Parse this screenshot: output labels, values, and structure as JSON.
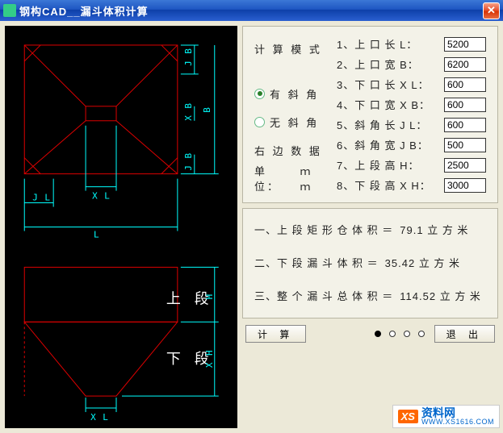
{
  "title": "钢构CAD__漏斗体积计算",
  "cad": {
    "labels": {
      "L": "L",
      "JL": "J L",
      "XL": "X L",
      "B": "B",
      "JB": "J B",
      "XB": "X B",
      "upper": "上 段",
      "lower": "下 段",
      "H": "H",
      "XH": "X H"
    }
  },
  "mode": {
    "title": "计 算 模 式",
    "opt1": "有 斜 角",
    "opt2": "无 斜 角",
    "rightdata": "右 边 数 据",
    "unit_lbl": "单 位：",
    "unit_val": "ｍｍ",
    "selected": "opt1"
  },
  "fields": [
    {
      "label": "1、上 口 长 L：",
      "value": "5200"
    },
    {
      "label": "2、上 口 宽 B：",
      "value": "6200"
    },
    {
      "label": "3、下 口 长 X L：",
      "value": "600"
    },
    {
      "label": "4、下 口 宽 X B：",
      "value": "600"
    },
    {
      "label": "5、斜 角 长 J L：",
      "value": "600"
    },
    {
      "label": "6、斜 角 宽 J B：",
      "value": "500"
    },
    {
      "label": "7、上 段 高 H：",
      "value": "2500"
    },
    {
      "label": "8、下 段 高 X H：",
      "value": "3000"
    }
  ],
  "results": {
    "r1_label": "一、上 段 矩 形 仓 体 积 ＝",
    "r1_value": "79.1 立 方 米",
    "r2_label": "二、下 段 漏 斗 体 积 ＝",
    "r2_value": "35.42 立 方 米",
    "r3_label": "三、整 个 漏 斗 总 体 积 ＝",
    "r3_value": "114.52 立 方 米"
  },
  "buttons": {
    "calc": "计   算",
    "exit": "退   出"
  },
  "pager": {
    "count": 4,
    "active": 0
  },
  "watermark": {
    "logo": "XS",
    "cn": "资料网",
    "url": "WWW.XS1616.COM"
  }
}
